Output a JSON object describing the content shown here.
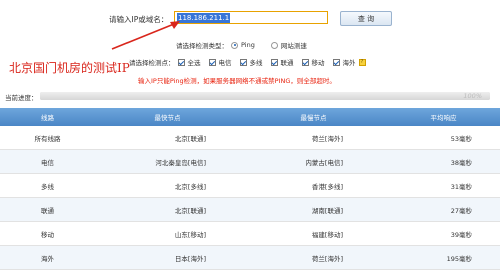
{
  "query": {
    "label": "请输入IP或域名：",
    "value": "118.186.211.1",
    "button": "查 询"
  },
  "probe_type": {
    "label": "请选择检测类型：",
    "options": [
      {
        "label": "Ping",
        "selected": true
      },
      {
        "label": "网站测速",
        "selected": false
      }
    ]
  },
  "probe_points": {
    "label": "请选择检测点：",
    "options": [
      {
        "label": "全选",
        "checked": true
      },
      {
        "label": "电信",
        "checked": true
      },
      {
        "label": "多线",
        "checked": true
      },
      {
        "label": "联通",
        "checked": true
      },
      {
        "label": "移动",
        "checked": true
      },
      {
        "label": "海外",
        "checked": true
      }
    ],
    "help_icon": "question-icon"
  },
  "watermark": "北京国门机房的测试IP",
  "note": "输入IP只能Ping检测，如果服务器网络不通或禁PING，则全部超时。",
  "progress": {
    "label": "当前进度：",
    "value": 100,
    "text": "100%"
  },
  "table": {
    "headers": [
      "线路",
      "最快节点",
      "最慢节点",
      "平均响应"
    ],
    "rows": [
      {
        "line": "所有线路",
        "fastest": "北京[联通]",
        "slowest": "荷兰[海外]",
        "avg": "53毫秒"
      },
      {
        "line": "电信",
        "fastest": "河北秦皇岛[电信]",
        "slowest": "内蒙古[电信]",
        "avg": "38毫秒"
      },
      {
        "line": "多线",
        "fastest": "北京[多线]",
        "slowest": "香港[多线]",
        "avg": "31毫秒"
      },
      {
        "line": "联通",
        "fastest": "北京[联通]",
        "slowest": "湖南[联通]",
        "avg": "27毫秒"
      },
      {
        "line": "移动",
        "fastest": "山东[移动]",
        "slowest": "福建[移动]",
        "avg": "39毫秒"
      },
      {
        "line": "海外",
        "fastest": "日本[海外]",
        "slowest": "荷兰[海外]",
        "avg": "195毫秒"
      }
    ]
  },
  "colors": {
    "accent": "#4a86c6",
    "input_border": "#e8a200",
    "warning": "#e8220e",
    "watermark": "#d9261c"
  }
}
